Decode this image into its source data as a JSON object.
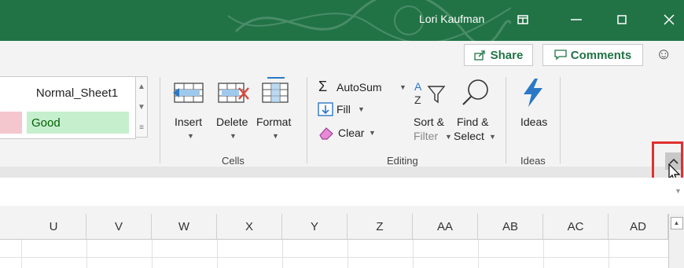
{
  "titlebar": {
    "user": "Lori Kaufman",
    "icons": [
      "ribbon-display-icon",
      "minimize-icon",
      "maximize-icon",
      "close-icon"
    ],
    "bg_color": "#217346"
  },
  "share_row": {
    "share_label": "Share",
    "comments_label": "Comments",
    "smiley_icon": "smiley-icon"
  },
  "styles": {
    "normal_label": "Normal_Sheet1",
    "good_label": "Good"
  },
  "cells": {
    "insert_label": "Insert",
    "delete_label": "Delete",
    "format_label": "Format",
    "group_label": "Cells"
  },
  "editing": {
    "autosum_label": "AutoSum",
    "fill_label": "Fill",
    "clear_label": "Clear",
    "sort_label_1": "Sort &",
    "sort_label_2": "Filter",
    "find_label_1": "Find &",
    "find_label_2": "Select",
    "group_label": "Editing"
  },
  "ideas": {
    "button_label": "Ideas",
    "group_label": "Ideas"
  },
  "columns": [
    "U",
    "V",
    "W",
    "X",
    "Y",
    "Z",
    "AA",
    "AB",
    "AC",
    "AD"
  ],
  "accent_color": "#217346",
  "highlight_color": "#e03030"
}
